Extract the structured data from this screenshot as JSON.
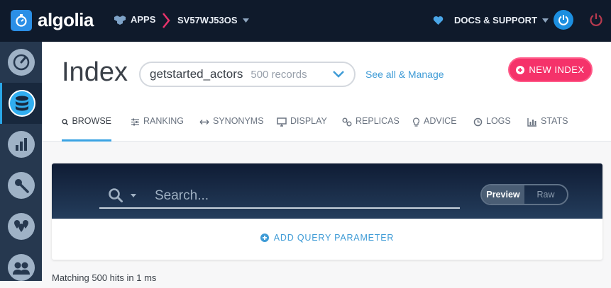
{
  "topbar": {
    "brand": "algolia",
    "apps_label": "APPS",
    "app_id": "SV57WJ53OS",
    "docs_label": "DOCS & SUPPORT"
  },
  "sidebar": {
    "items": [
      {
        "icon": "dashboard-gauge-icon"
      },
      {
        "icon": "database-icon",
        "active": true
      },
      {
        "icon": "analytics-icon"
      },
      {
        "icon": "api-key-icon"
      },
      {
        "icon": "geo-pins-icon"
      },
      {
        "icon": "team-icon"
      }
    ]
  },
  "header": {
    "title": "Index",
    "index_name": "getstarted_actors",
    "record_count": "500 records",
    "see_all": "See all & Manage",
    "new_index": "NEW INDEX"
  },
  "tabs": [
    {
      "label": "BROWSE",
      "icon": "search-icon",
      "active": true
    },
    {
      "label": "RANKING",
      "icon": "sliders-icon"
    },
    {
      "label": "SYNONYMS",
      "icon": "arrows-icon"
    },
    {
      "label": "DISPLAY",
      "icon": "monitor-icon"
    },
    {
      "label": "REPLICAS",
      "icon": "link-icon"
    },
    {
      "label": "ADVICE",
      "icon": "lightbulb-icon"
    },
    {
      "label": "LOGS",
      "icon": "clock-icon"
    },
    {
      "label": "STATS",
      "icon": "bar-chart-icon"
    }
  ],
  "search": {
    "placeholder": "Search...",
    "preview_label": "Preview",
    "raw_label": "Raw",
    "add_param": "ADD QUERY PARAMETER"
  },
  "results": {
    "matching": "Matching 500 hits in 1 ms"
  },
  "colors": {
    "topbar": "#0f1a2b",
    "sidebar": "#26384f",
    "accent_blue": "#3aa3e3",
    "new_index": "#f5326a"
  }
}
